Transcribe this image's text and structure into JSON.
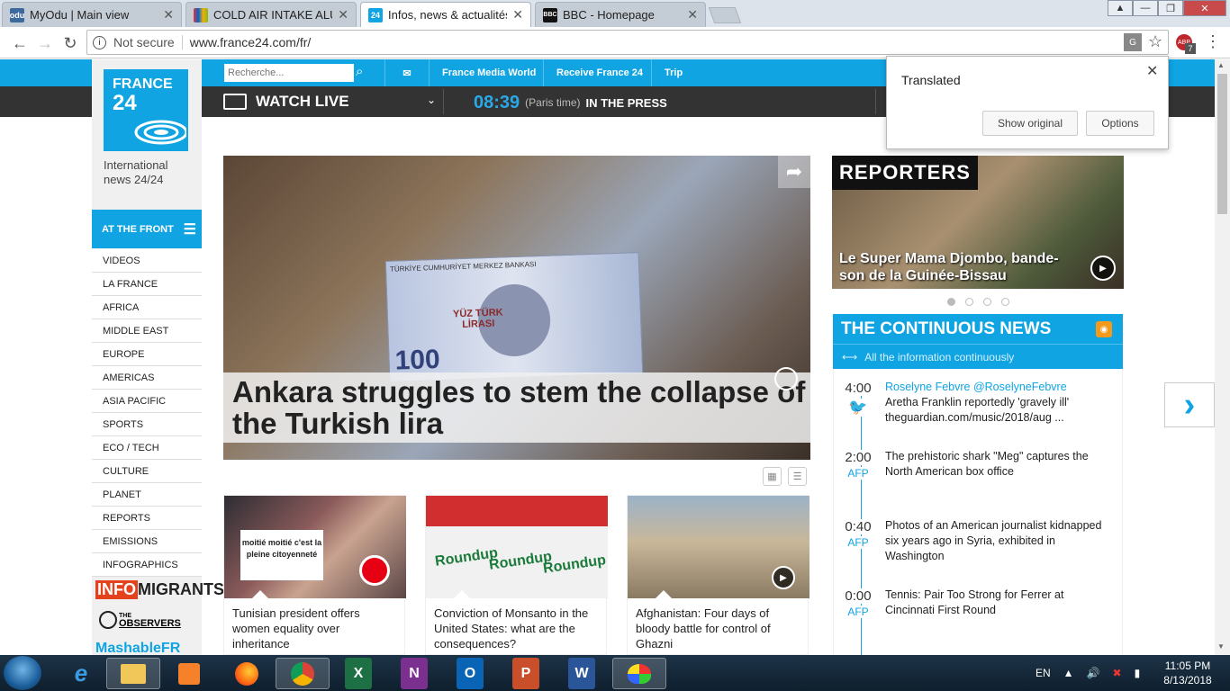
{
  "browser": {
    "tabs": [
      {
        "title": "MyOdu | Main view",
        "favicon": "odu"
      },
      {
        "title": "COLD AIR INTAKE ALUMI",
        "favicon": "ebay"
      },
      {
        "title": "Infos, news & actualités",
        "favicon": "f24"
      },
      {
        "title": "BBC - Homepage",
        "favicon": "BBC"
      }
    ],
    "security_label": "Not secure",
    "url": "www.france24.com/fr/",
    "extension_badge": "7"
  },
  "translate_popup": {
    "label": "Translated",
    "show_original": "Show original",
    "options": "Options"
  },
  "site": {
    "search_placeholder": "Recherche...",
    "nav": [
      "France Media World",
      "Receive France 24",
      "Trip"
    ],
    "watch_live": "WATCH LIVE",
    "time": "08:39",
    "paris_time": "(Paris time)",
    "in_the_press": "IN THE PRESS",
    "logo_top": "FRANCE",
    "logo_num": "24",
    "tagline": "International news 24/24",
    "at_the_front": "AT THE FRONT",
    "menu": [
      "VIDEOS",
      "LA FRANCE",
      "AFRICA",
      "MIDDLE EAST",
      "EUROPE",
      "AMERICAS",
      "ASIA PACIFIC",
      "SPORTS",
      "ECO / TECH",
      "CULTURE",
      "PLANET",
      "REPORTS",
      "EMISSIONS",
      "INFOGRAPHICS"
    ],
    "brands": {
      "info": "INFO",
      "migrants": "MIGRANTS",
      "the": "THE",
      "observers": "OBSERVERS",
      "mashable": "MashableFR"
    }
  },
  "hero": {
    "title": "Ankara struggles to stem the collapse of the Turkish lira",
    "note_header": "TÜRKİYE CUMHURİYET MERKEZ BANKASI",
    "note_value": "100",
    "note_text": "YÜZ TÜRK LİRASI"
  },
  "cards": [
    {
      "caption": "Tunisian president offers women equality over inheritance",
      "sign": "moitié moitié c'est la pleine citoyenneté"
    },
    {
      "caption": "Conviction of Monsanto in the United States: what are the consequences?",
      "brand": "Roundup"
    },
    {
      "caption": "Afghanistan: Four days of bloody battle for control of Ghazni"
    }
  ],
  "reporters": {
    "logo": "REPORTERS",
    "title": "Le Super Mama Djombo, bande-son de la Guinée-Bissau"
  },
  "continuous_news": {
    "header": "THE CONTINUOUS NEWS",
    "subheader": "All the information continuously",
    "items": [
      {
        "time": "4:00",
        "source": "",
        "author": "Roselyne Febvre @RoselyneFebvre",
        "text": "Aretha Franklin reportedly 'gravely ill' theguardian.com/music/2018/aug ..."
      },
      {
        "time": "2:00",
        "source": "AFP",
        "author": "",
        "text": "The prehistoric shark \"Meg\" captures the North American box office"
      },
      {
        "time": "0:40",
        "source": "AFP",
        "author": "",
        "text": "Photos of an American journalist kidnapped six years ago in Syria, exhibited in Washington"
      },
      {
        "time": "0:00",
        "source": "AFP",
        "author": "",
        "text": "Tennis: Pair Too Strong for Ferrer at Cincinnati First Round"
      }
    ]
  },
  "taskbar": {
    "language": "EN",
    "time": "11:05 PM",
    "date": "8/13/2018",
    "apps": [
      "e",
      "",
      "",
      "",
      "",
      "X",
      "N",
      "O",
      "P",
      "W",
      ""
    ]
  },
  "colors": {
    "brand_blue": "#10a4e2",
    "dark_bar": "#333333"
  }
}
